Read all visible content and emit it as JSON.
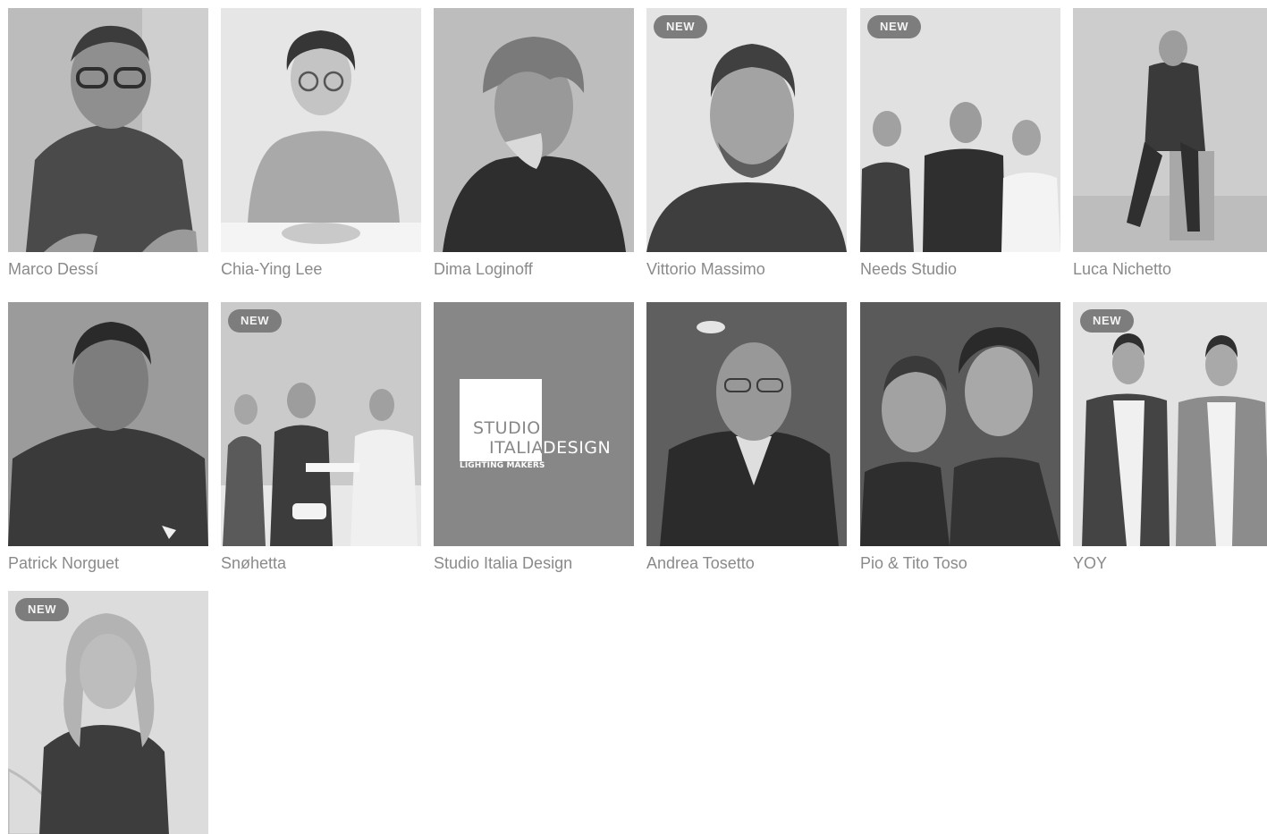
{
  "badge_label": "NEW",
  "designers": [
    {
      "name": "Marco Dessí",
      "is_new": false
    },
    {
      "name": "Chia-Ying Lee",
      "is_new": false
    },
    {
      "name": "Dima Loginoff",
      "is_new": false
    },
    {
      "name": "Vittorio Massimo",
      "is_new": true
    },
    {
      "name": "Needs Studio",
      "is_new": true
    },
    {
      "name": "Luca Nichetto",
      "is_new": false
    },
    {
      "name": "Patrick Norguet",
      "is_new": false
    },
    {
      "name": "Snøhetta",
      "is_new": true
    },
    {
      "name": "Studio Italia Design",
      "is_new": false
    },
    {
      "name": "Andrea Tosetto",
      "is_new": false
    },
    {
      "name": "Pio & Tito Toso",
      "is_new": false
    },
    {
      "name": "YOY",
      "is_new": true
    },
    {
      "name": "",
      "is_new": true
    }
  ],
  "studio_logo": {
    "line1": "STUDIO",
    "line2": "ITALIA",
    "line3": "DESIGN",
    "subline": "LIGHTING MAKERS"
  },
  "colors": {
    "badge_bg": "#7d7d7d",
    "name_text": "#8a8a8a",
    "logo_bg": "#878787"
  }
}
